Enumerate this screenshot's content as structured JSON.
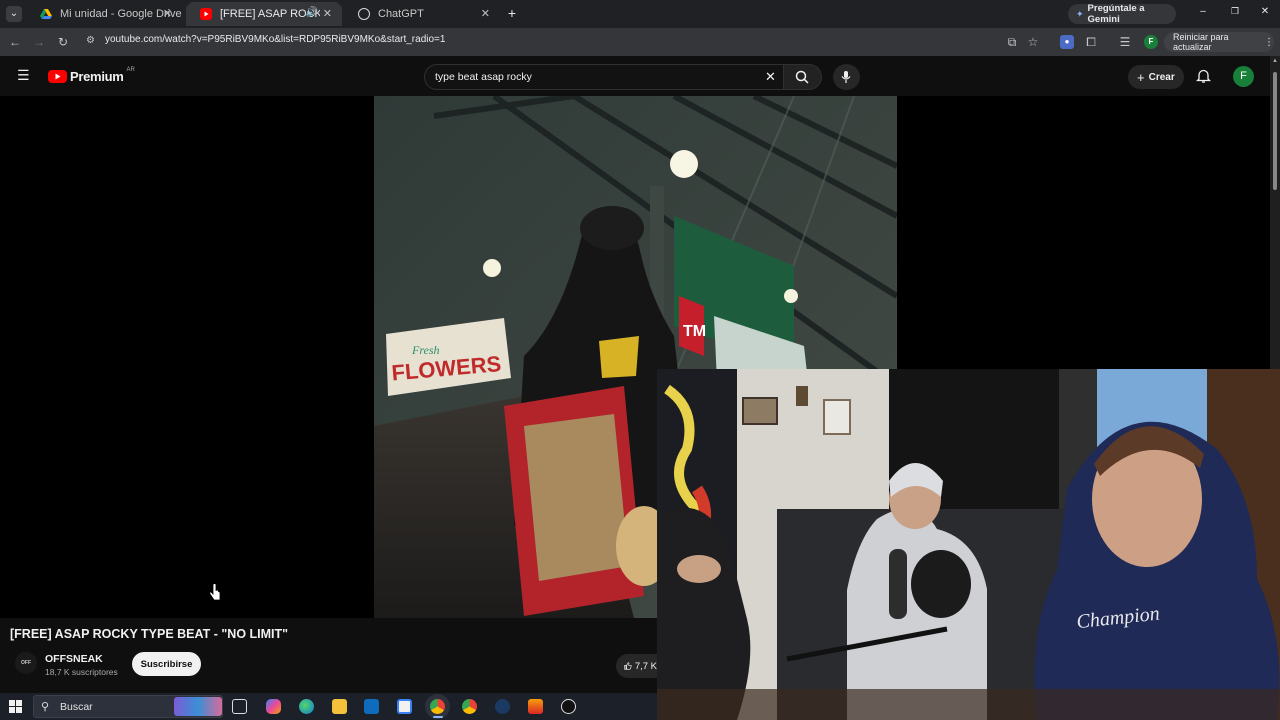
{
  "browser": {
    "tabs": [
      {
        "title": "Mi unidad - Google Drive",
        "favicon_color": "#34a853"
      },
      {
        "title": "[FREE] ASAP ROCKY TYPE B",
        "favicon_color": "#ff0000",
        "active": true
      },
      {
        "title": "ChatGPT",
        "favicon_color": "#d9d9d9"
      }
    ],
    "new_tab_label": "+",
    "gemini_label": "Pregúntale a Gemini",
    "url": "youtube.com/watch?v=P95RiBV9MKo&list=RDP95RiBV9MKo&start_radio=1",
    "profile_initial": "F",
    "update_label": "Reiniciar para actualizar"
  },
  "youtube": {
    "logo_text": "Premium",
    "region": "AR",
    "search_value": "type beat asap rocky",
    "create_label": "Crear",
    "avatar_initial": "F"
  },
  "video": {
    "title": "[FREE] ASAP ROCKY TYPE BEAT - \"NO LIMIT\"",
    "channel_name": "OFFSNEAK",
    "channel_avatar_text": "OFF",
    "subscribers": "18,7 K suscriptores",
    "subscribe_label": "Suscribirse",
    "likes": "7,7 K",
    "sign_word_1": "Fresh",
    "sign_word_2": "FLOWERS",
    "sign_tm": "TM"
  },
  "facecam": {
    "hoodie_text": "Champion"
  },
  "taskbar": {
    "search_placeholder": "Buscar"
  },
  "colors": {
    "youtube_red": "#ff0000",
    "accent_green": "#1e8e3e",
    "profile_green": "#188038"
  }
}
